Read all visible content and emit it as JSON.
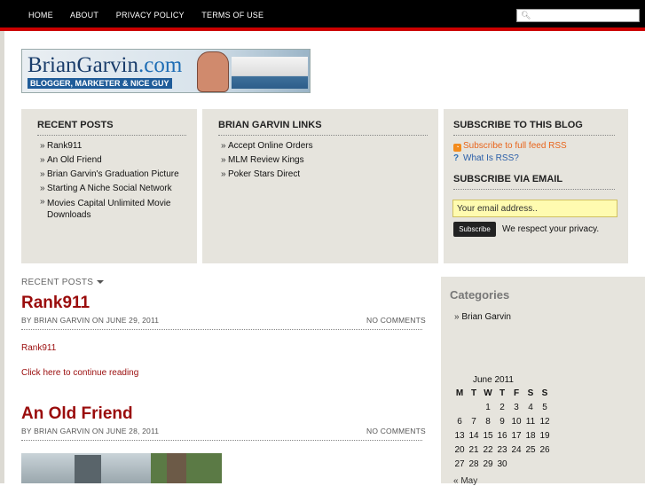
{
  "nav": {
    "items": [
      "HOME",
      "ABOUT",
      "PRIVACY POLICY",
      "TERMS OF USE"
    ],
    "search_placeholder": ""
  },
  "logo": {
    "name": "BrianGarvin",
    "tld": ".com",
    "tagline": "BLOGGER, MARKETER & NICE GUY"
  },
  "widgets": {
    "recent_posts": {
      "title": "RECENT POSTS",
      "items": [
        "Rank911",
        "An Old Friend",
        "Brian Garvin's Graduation Picture",
        "Starting A Niche Social Network",
        "Movies Capital Unlimited Movie Downloads"
      ]
    },
    "links": {
      "title": "BRIAN GARVIN LINKS",
      "items": [
        "Accept Online Orders",
        "MLM Review Kings",
        "Poker Stars Direct"
      ]
    },
    "subscribe": {
      "title": "SUBSCRIBE TO THIS BLOG",
      "rss_label": "Subscribe to full feed RSS",
      "what_rss": "What Is RSS?",
      "email_title": "SUBSCRIBE VIA EMAIL",
      "email_placeholder": "Your email address..",
      "button": "Subscribe",
      "privacy": "We respect your privacy."
    }
  },
  "main": {
    "section_label": "RECENT POSTS",
    "posts": [
      {
        "title": "Rank911",
        "meta": "BY BRIAN GARVIN ON JUNE 29, 2011",
        "comments": "NO COMMENTS",
        "body_link": "Rank911",
        "more": "Click here to continue reading"
      },
      {
        "title": "An Old Friend",
        "meta": "BY BRIAN GARVIN ON JUNE 28, 2011",
        "comments": "NO COMMENTS"
      }
    ]
  },
  "sidebar": {
    "categories_title": "Categories",
    "categories": [
      "Brian Garvin"
    ],
    "calendar": {
      "caption": "June 2011",
      "days": [
        "M",
        "T",
        "W",
        "T",
        "F",
        "S",
        "S"
      ],
      "weeks": [
        [
          "",
          "",
          "1",
          "2",
          "3",
          "4",
          "5"
        ],
        [
          "6",
          "7",
          "8",
          "9",
          "10",
          "11",
          "12"
        ],
        [
          "13",
          "14",
          "15",
          "16",
          "17",
          "18",
          "19"
        ],
        [
          "20",
          "21",
          "22",
          "23",
          "24",
          "25",
          "26"
        ],
        [
          "27",
          "28",
          "29",
          "30",
          "",
          "",
          ""
        ]
      ],
      "linked_days": [
        "26",
        "29"
      ],
      "prev": "« May"
    }
  },
  "colors": {
    "topbar": "#000000",
    "accent_red": "#cc0000",
    "post_title": "#9a0c0c",
    "panel_bg": "#e6e4dd"
  },
  "icons": [
    "search-icon",
    "rss-icon",
    "question-icon",
    "caret-down-icon"
  ]
}
